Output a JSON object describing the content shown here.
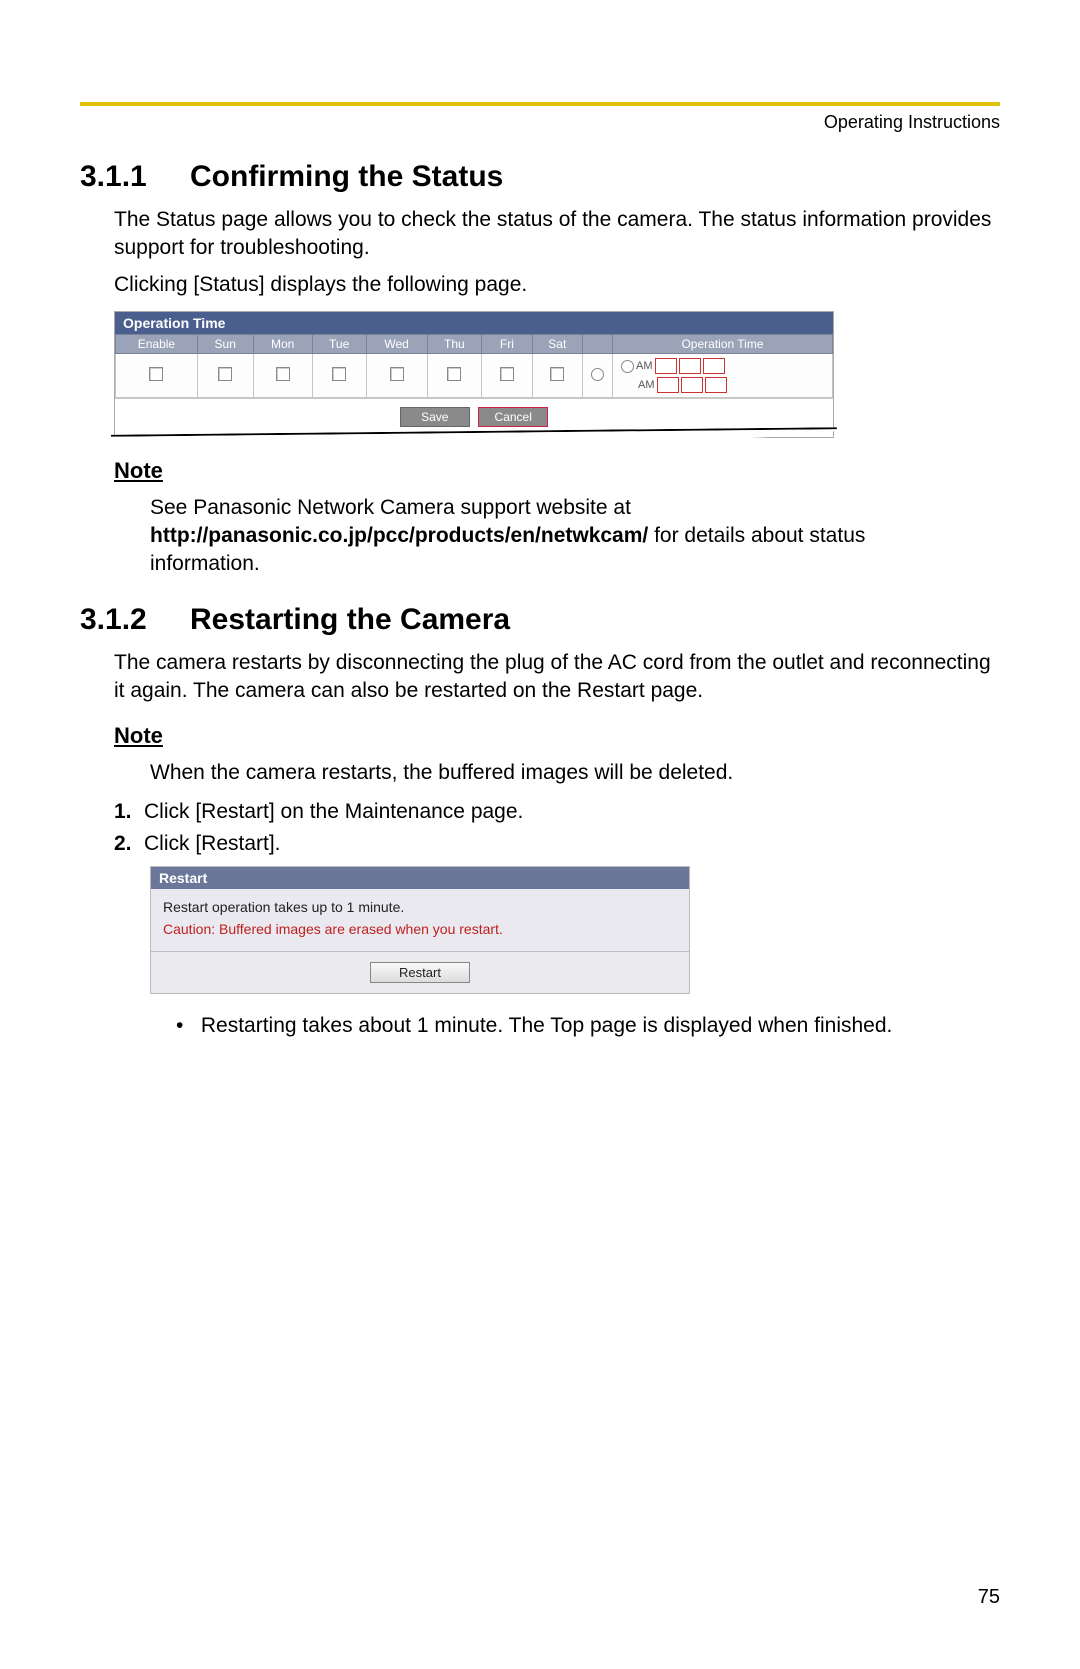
{
  "header": {
    "label": "Operating Instructions"
  },
  "page_number": "75",
  "section_311": {
    "number": "3.1.1",
    "title": "Confirming the Status",
    "paragraphs": [
      "The Status page allows you to check the status of the camera. The status information provides support for troubleshooting.",
      "Clicking [Status] displays the following page."
    ],
    "note_label": "Note",
    "note_text_pre": "See Panasonic Network Camera support website at ",
    "note_bold": "http://panasonic.co.jp/pcc/products/en/netwkcam/",
    "note_text_post": " for details about status information."
  },
  "op_fig": {
    "title": "Operation Time",
    "columns": [
      "Enable",
      "Sun",
      "Mon",
      "Tue",
      "Wed",
      "Thu",
      "Fri",
      "Sat",
      "",
      "Operation Time"
    ],
    "radio_label_always": "",
    "am_label": "AM",
    "buttons": {
      "save": "Save",
      "cancel": "Cancel"
    }
  },
  "section_312": {
    "number": "3.1.2",
    "title": "Restarting the Camera",
    "paragraph": "The camera restarts by disconnecting the plug of the AC cord from the outlet and reconnecting it again. The camera can also be restarted on the Restart page.",
    "note_label": "Note",
    "note_text": "When the camera restarts, the buffered images will be deleted.",
    "steps": [
      "Click [Restart] on the Maintenance page.",
      "Click [Restart]."
    ],
    "bullet": "Restarting takes about 1 minute. The Top page is displayed when finished."
  },
  "restart_fig": {
    "title": "Restart",
    "line1": "Restart operation takes up to 1 minute.",
    "line2": "Caution: Buffered images are erased when you restart.",
    "button": "Restart"
  }
}
